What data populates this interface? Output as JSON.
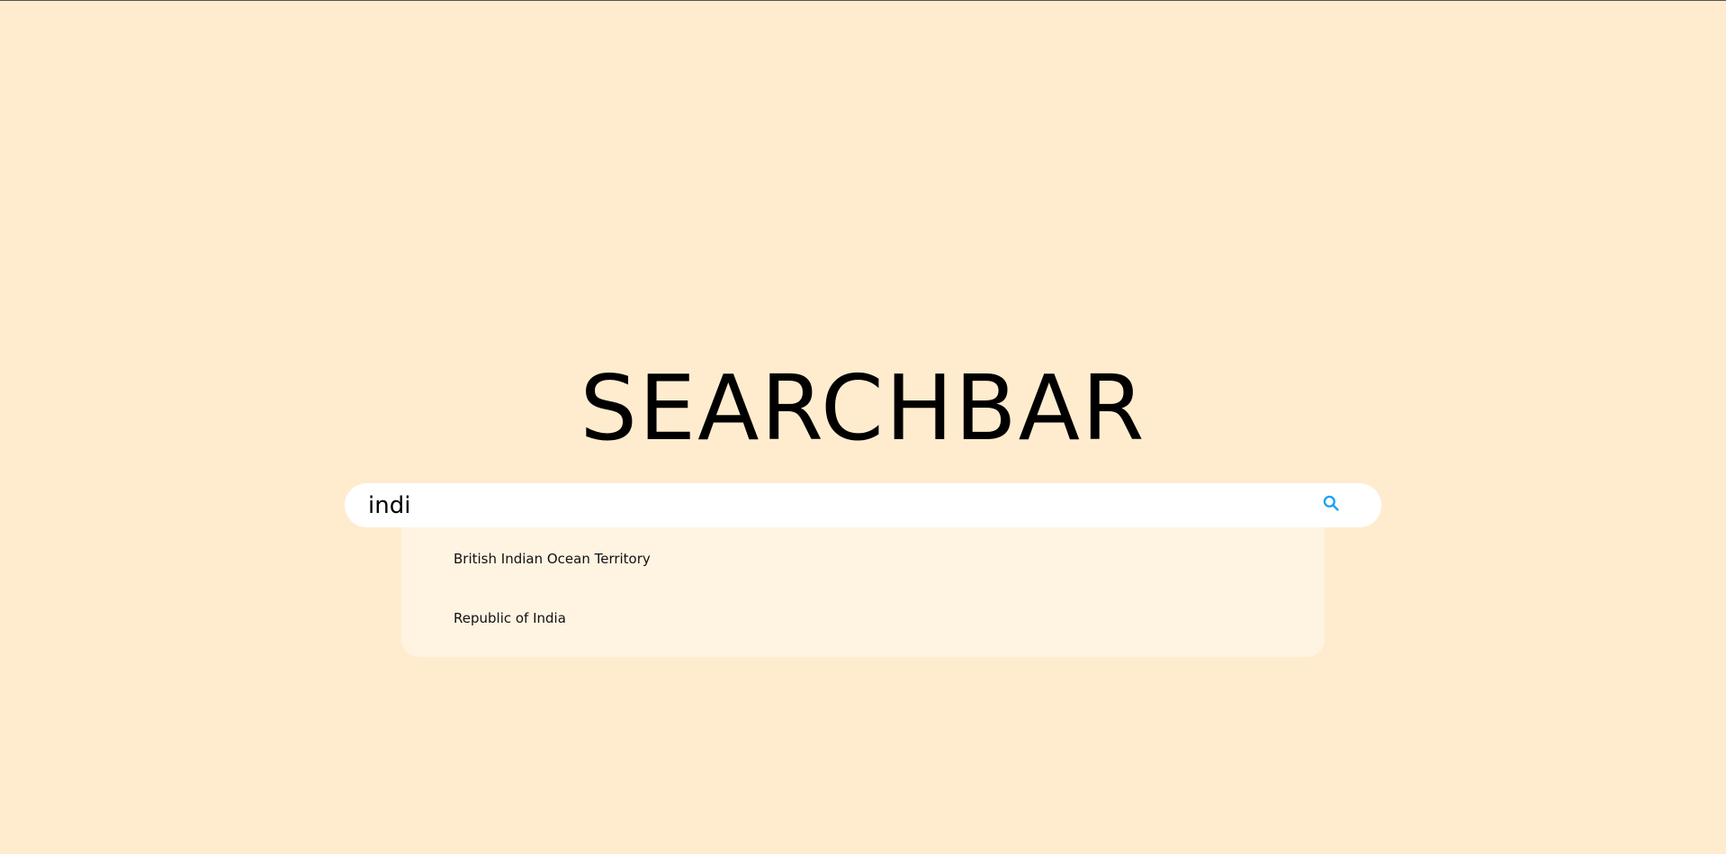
{
  "page": {
    "title": "SEARCHBAR",
    "background_color": "#FFECCF"
  },
  "search": {
    "value": "indi",
    "icon": "search-icon",
    "icon_color": "#1DA1F2"
  },
  "results": {
    "items": [
      {
        "label": "British Indian Ocean Territory"
      },
      {
        "label": "Republic of India"
      }
    ]
  }
}
